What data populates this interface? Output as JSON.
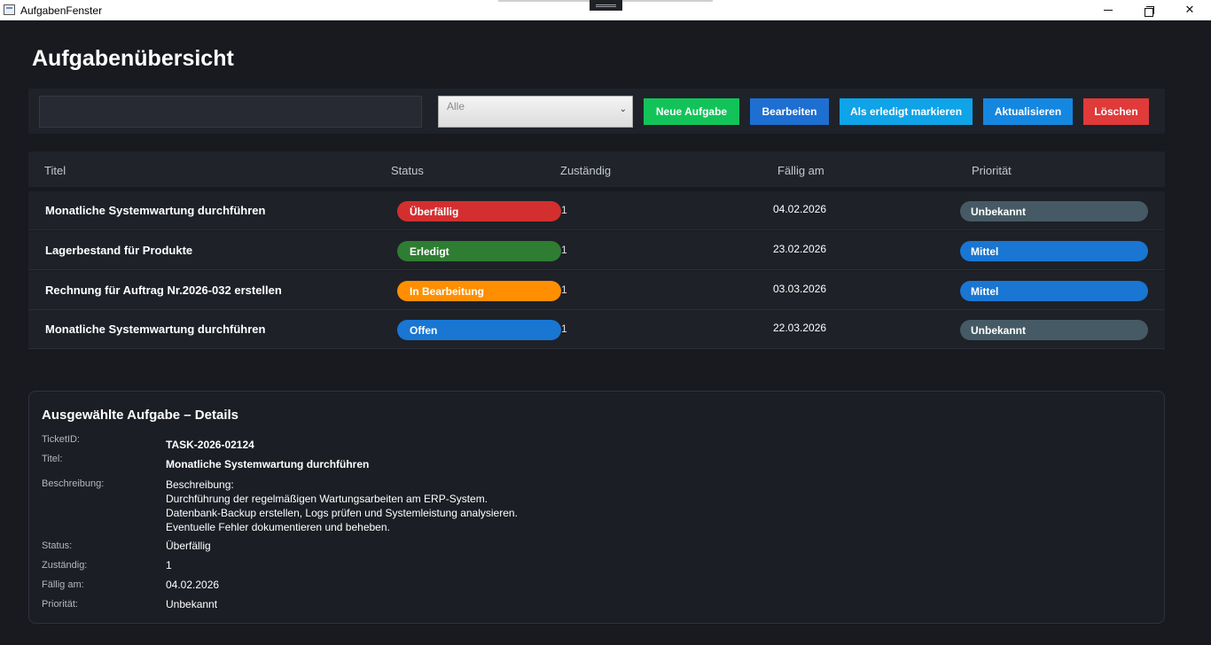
{
  "window": {
    "title": "AufgabenFenster"
  },
  "page": {
    "title": "Aufgabenübersicht"
  },
  "toolbar": {
    "search_value": "",
    "filter_selected": "Alle",
    "buttons": {
      "new": "Neue Aufgabe",
      "edit": "Bearbeiten",
      "mark_done": "Als erledigt markieren",
      "refresh": "Aktualisieren",
      "delete": "Löschen"
    },
    "button_colors": {
      "new": "#12c35a",
      "edit": "#1d6fd1",
      "mark_done": "#0fa3e8",
      "refresh": "#1487e0",
      "delete": "#e03a3a"
    }
  },
  "table": {
    "columns": [
      "Titel",
      "Status",
      "Zuständig",
      "Fällig am",
      "Priorität"
    ],
    "rows": [
      {
        "title": "Monatliche Systemwartung durchführen",
        "status": "Überfällig",
        "status_color": "#d32f2f",
        "assignee": "1",
        "due": "04.02.2026",
        "priority": "Unbekannt",
        "priority_color": "#455a64"
      },
      {
        "title": "Lagerbestand für Produkte",
        "status": "Erledigt",
        "status_color": "#2e7d32",
        "assignee": "1",
        "due": "23.02.2026",
        "priority": "Mittel",
        "priority_color": "#1976d2"
      },
      {
        "title": "Rechnung für Auftrag Nr.2026-032 erstellen",
        "status": "In Bearbeitung",
        "status_color": "#ff8f00",
        "assignee": "1",
        "due": "03.03.2026",
        "priority": "Mittel",
        "priority_color": "#1976d2"
      },
      {
        "title": "Monatliche Systemwartung durchführen",
        "status": "Offen",
        "status_color": "#1976d2",
        "assignee": "1",
        "due": "22.03.2026",
        "priority": "Unbekannt",
        "priority_color": "#455a64"
      }
    ]
  },
  "details": {
    "heading": "Ausgewählte Aufgabe – Details",
    "labels": {
      "ticket_id": "TicketID:",
      "title": "Titel:",
      "description": "Beschreibung:",
      "status": "Status:",
      "assignee": "Zuständig:",
      "due": "Fällig am:",
      "priority": "Priorität:"
    },
    "values": {
      "ticket_id": "TASK-2026-02124",
      "title": "Monatliche Systemwartung durchführen",
      "description_lines": [
        "Beschreibung:",
        "Durchführung der regelmäßigen Wartungsarbeiten am ERP-System.",
        "Datenbank-Backup erstellen, Logs prüfen und Systemleistung analysieren.",
        "Eventuelle Fehler dokumentieren und beheben."
      ],
      "status": "Überfällig",
      "assignee": "1",
      "due": "04.02.2026",
      "priority": "Unbekannt"
    }
  },
  "icons": {
    "app": "window-app-icon",
    "minimize": "minimize-icon",
    "maximize": "restore-icon",
    "close": "close-icon",
    "dropdown": "chevron-down-icon"
  }
}
